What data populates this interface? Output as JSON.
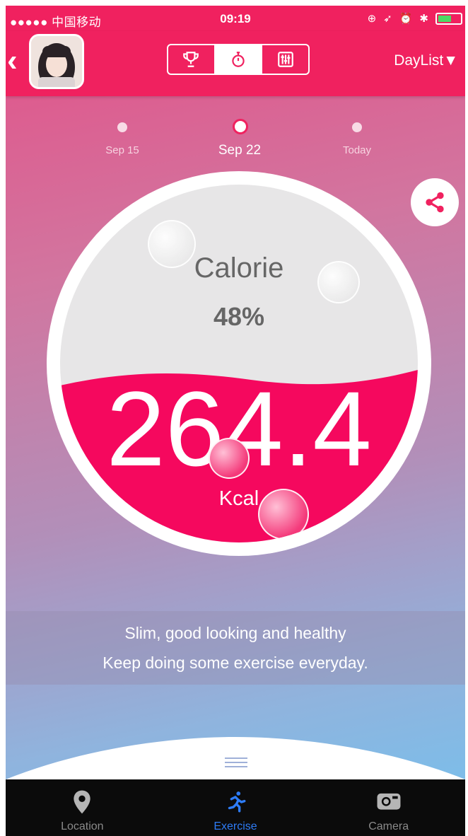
{
  "status_bar": {
    "carrier": "●●●●● 中国移动 ",
    "time": "09:19"
  },
  "nav": {
    "daylist_label": "DayList▼",
    "segments": [
      "trophy-icon",
      "stopwatch-icon",
      "equalizer-icon"
    ],
    "active_segment": "stopwatch-icon"
  },
  "timeline": [
    {
      "label": "Sep 15",
      "selected": false
    },
    {
      "label": "Sep 22",
      "selected": true
    },
    {
      "label": "Today",
      "selected": false
    }
  ],
  "gauge": {
    "title": "Calorie",
    "percent_label": "48%",
    "fill_fraction": 0.48,
    "value": "264.4",
    "unit": "Kcal"
  },
  "motivation": {
    "line1": "Slim, good looking and healthy",
    "line2": "Keep doing some exercise everyday."
  },
  "tabbar": [
    {
      "label": "Location",
      "icon": "location-pin-icon",
      "active": false
    },
    {
      "label": "Exercise",
      "icon": "runner-icon",
      "active": true
    },
    {
      "label": "Camera",
      "icon": "camera-icon",
      "active": false
    }
  ],
  "colors": {
    "accent": "#f0215f",
    "tab_active": "#2e7cf6"
  }
}
